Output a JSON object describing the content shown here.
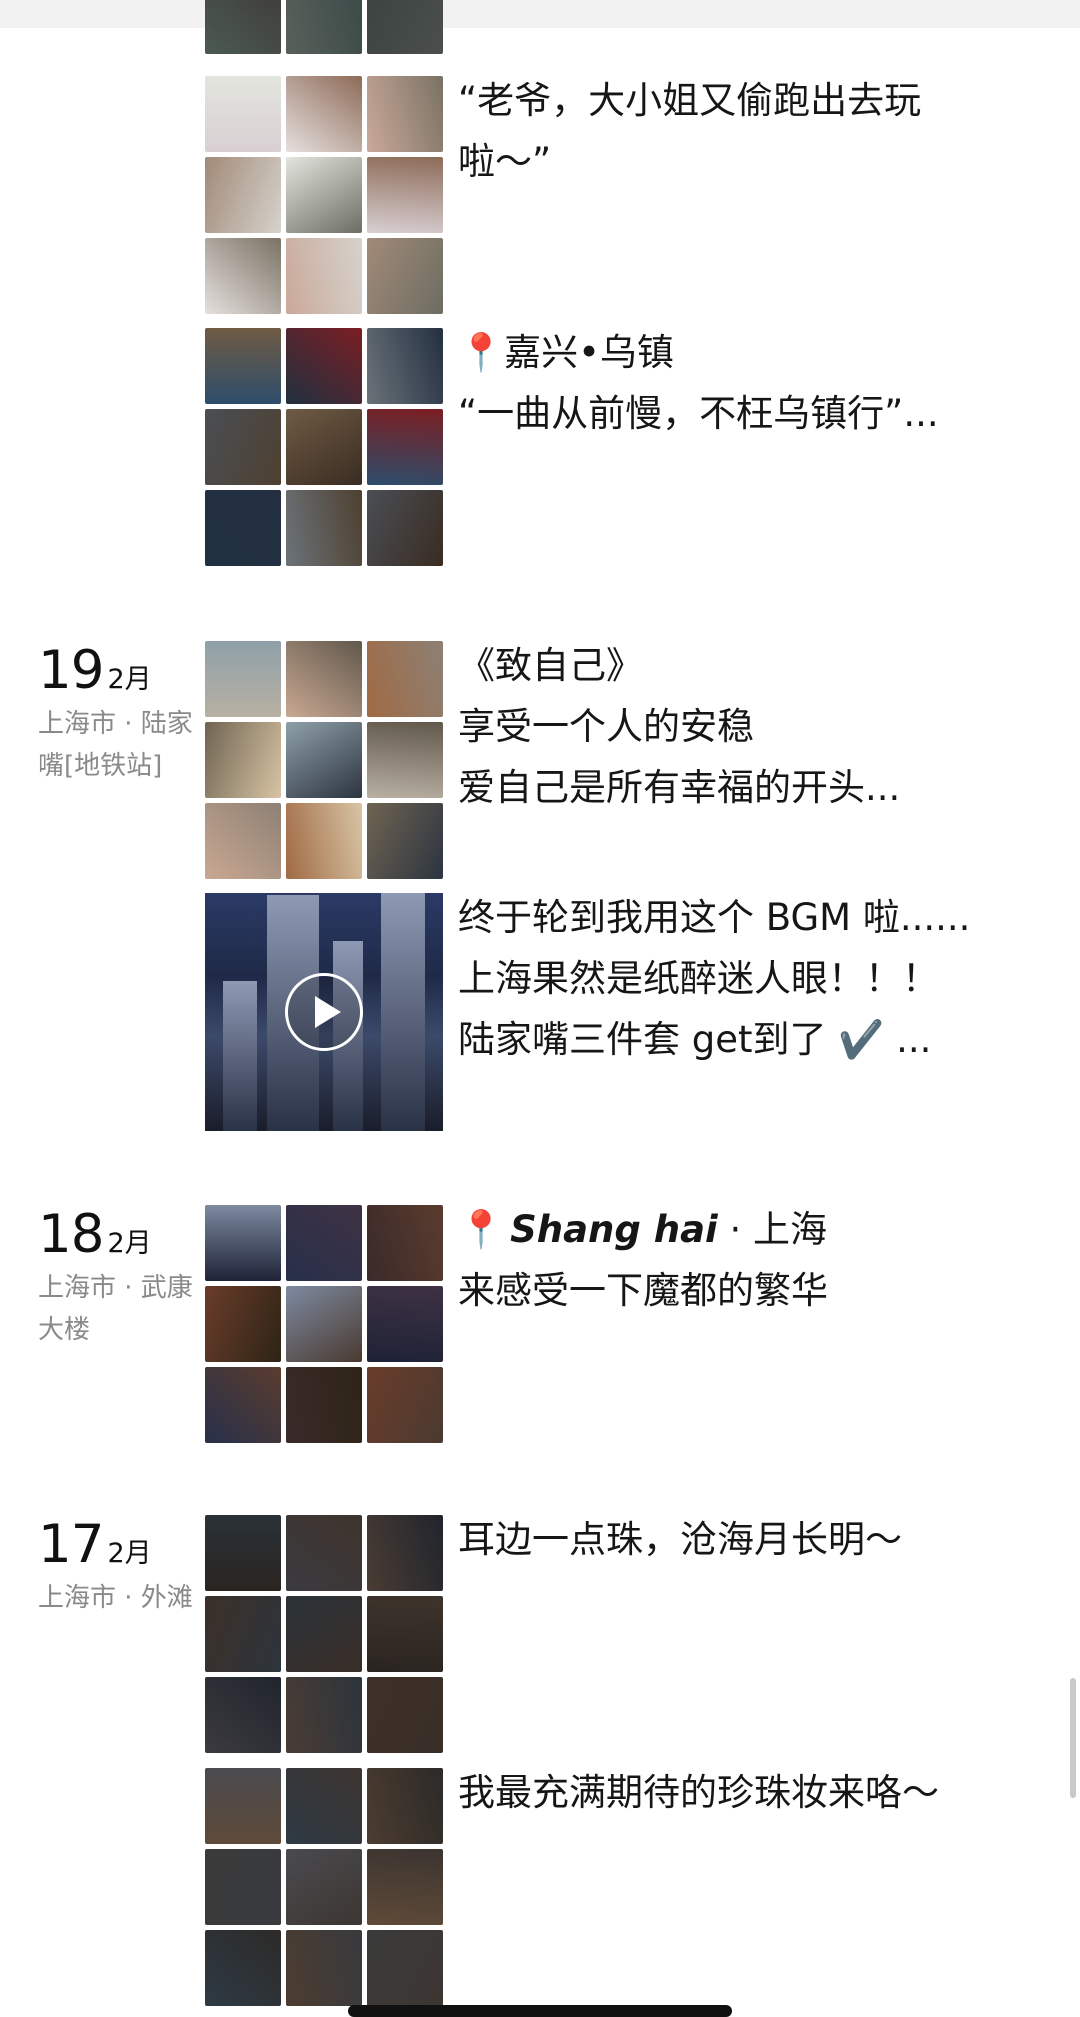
{
  "entries": [
    {
      "date_day": "",
      "date_month": "",
      "date_location": "",
      "posts": [
        {
          "kind": "grid",
          "palette": [
            "#3a3f38",
            "#4b5a52",
            "#59605a",
            "#3c4240",
            "#617070",
            "#4d4a42",
            "#3e3a38",
            "#3b4a48",
            "#4a4f4c"
          ],
          "caption_lines": []
        }
      ]
    },
    {
      "date_day": "",
      "date_month": "",
      "date_location": "",
      "posts": [
        {
          "kind": "grid",
          "palette": [
            "#d8cfd2",
            "#e6e0de",
            "#caa99a",
            "#a18a78",
            "#e3e5de",
            "#8d6b58",
            "#7a7264",
            "#d6d2cc",
            "#6d6d62"
          ],
          "caption_lines": [
            "“老爷，大小姐又偷跑出去玩",
            "啦～”"
          ]
        },
        {
          "kind": "grid",
          "palette": [
            "#2d4d6b",
            "#203040",
            "#6b7379",
            "#4a4e54",
            "#6f5b44",
            "#7b1e22",
            "#243042",
            "#4e4030",
            "#3a2c22"
          ],
          "caption_lines": [
            "📍嘉兴•乌镇",
            "",
            "“一曲从前慢，不枉乌镇行”..."
          ]
        }
      ]
    },
    {
      "date_day": "19",
      "date_month": "2月",
      "date_location": "上海市 · 陆家嘴[地铁站]",
      "posts": [
        {
          "kind": "grid",
          "palette": [
            "#b8b0a2",
            "#c9a892",
            "#a06a44",
            "#6f6452",
            "#8fa0a8",
            "#61584c",
            "#8d8074",
            "#d8c4a4",
            "#2c3440"
          ],
          "caption_lines": [
            "《致自己》",
            "享受一个人的安稳",
            "爱自己是所有幸福的开头..."
          ]
        },
        {
          "kind": "video",
          "caption_lines": [
            "终于轮到我用这个 BGM 啦......",
            "上海果然是纸醉迷人眼！！！",
            "陆家嘴三件套 get到了 ✔️ ..."
          ]
        }
      ]
    },
    {
      "date_day": "18",
      "date_month": "2月",
      "date_location": "上海市 · 武康大楼",
      "posts": [
        {
          "kind": "grid",
          "palette": [
            "#1e2236",
            "#27304a",
            "#3a2a2a",
            "#6a3c2a",
            "#7d8aa0",
            "#3e3244",
            "#5a3c2e",
            "#2d2416",
            "#4a3a30"
          ],
          "caption_lines": [
            "📍Shang hai · 上海",
            "来感受一下魔都的繁华"
          ]
        }
      ]
    },
    {
      "date_day": "17",
      "date_month": "2月",
      "date_location": "上海市 · 外滩",
      "posts": [
        {
          "kind": "grid",
          "palette": [
            "#2a2420",
            "#3b3a40",
            "#4a3c34",
            "#3c3028",
            "#2a3238",
            "#3e342c",
            "#20252c",
            "#2c343c",
            "#3a2e28"
          ],
          "caption_lines": [
            "耳边一点珠，沧海月长明～"
          ]
        },
        {
          "kind": "grid",
          "palette": [
            "#5e4a38",
            "#2e3a44",
            "#4c3c30",
            "#3a3a3a",
            "#4a4a4e",
            "#3c3430",
            "#2c2a28",
            "#383a3e",
            "#3c3632"
          ],
          "caption_lines": [
            "我最充满期待的珍珠妆来咯～"
          ]
        }
      ]
    }
  ]
}
